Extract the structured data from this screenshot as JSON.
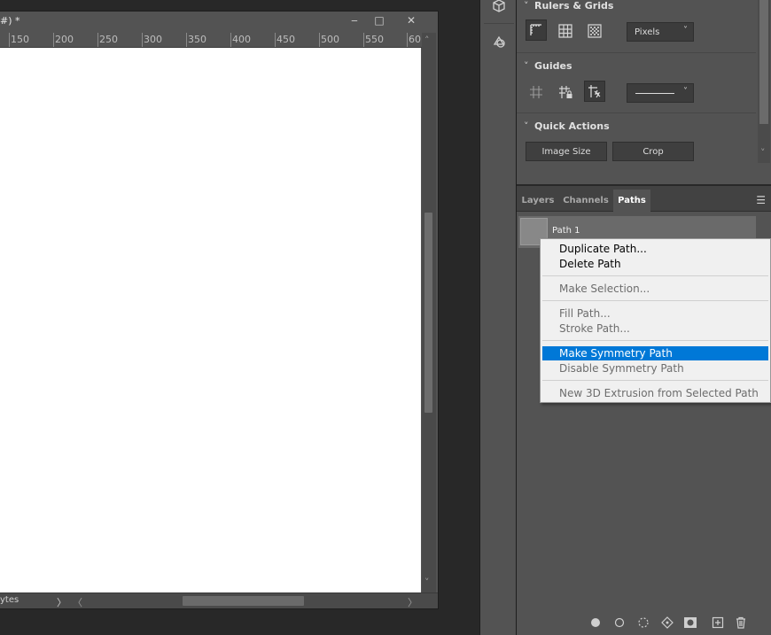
{
  "document": {
    "title": "#) *",
    "ruler_labels": [
      "150",
      "200",
      "250",
      "300",
      "350",
      "400",
      "450",
      "500",
      "550",
      "60"
    ],
    "status_text": "ytes",
    "window_buttons": {
      "minimize": "‒",
      "restore": "□",
      "close": "✕"
    }
  },
  "properties": {
    "sections": {
      "rulers_grids": "Rulers & Grids",
      "guides": "Guides",
      "quick_actions": "Quick Actions"
    },
    "units_dropdown": "Pixels",
    "guide_style_dropdown": "",
    "buttons": {
      "image_size": "Image Size",
      "crop": "Crop"
    }
  },
  "paths_panel": {
    "tabs": [
      "Layers",
      "Channels",
      "Paths"
    ],
    "active_tab": "Paths",
    "paths": [
      {
        "name": "Path 1"
      }
    ]
  },
  "context_menu": {
    "items": [
      {
        "label": "Duplicate Path...",
        "enabled": true
      },
      {
        "label": "Delete Path",
        "enabled": true
      },
      {
        "label": "Make Selection...",
        "enabled": false
      },
      {
        "label": "Fill Path...",
        "enabled": false
      },
      {
        "label": "Stroke Path...",
        "enabled": false
      },
      {
        "label": "Make Symmetry Path",
        "enabled": true,
        "highlighted": true
      },
      {
        "label": "Disable Symmetry Path",
        "enabled": false
      },
      {
        "label": "New 3D Extrusion from Selected Path",
        "enabled": false
      }
    ]
  },
  "colors": {
    "highlight": "#0078d7",
    "panel": "#535353",
    "background": "#282828"
  }
}
